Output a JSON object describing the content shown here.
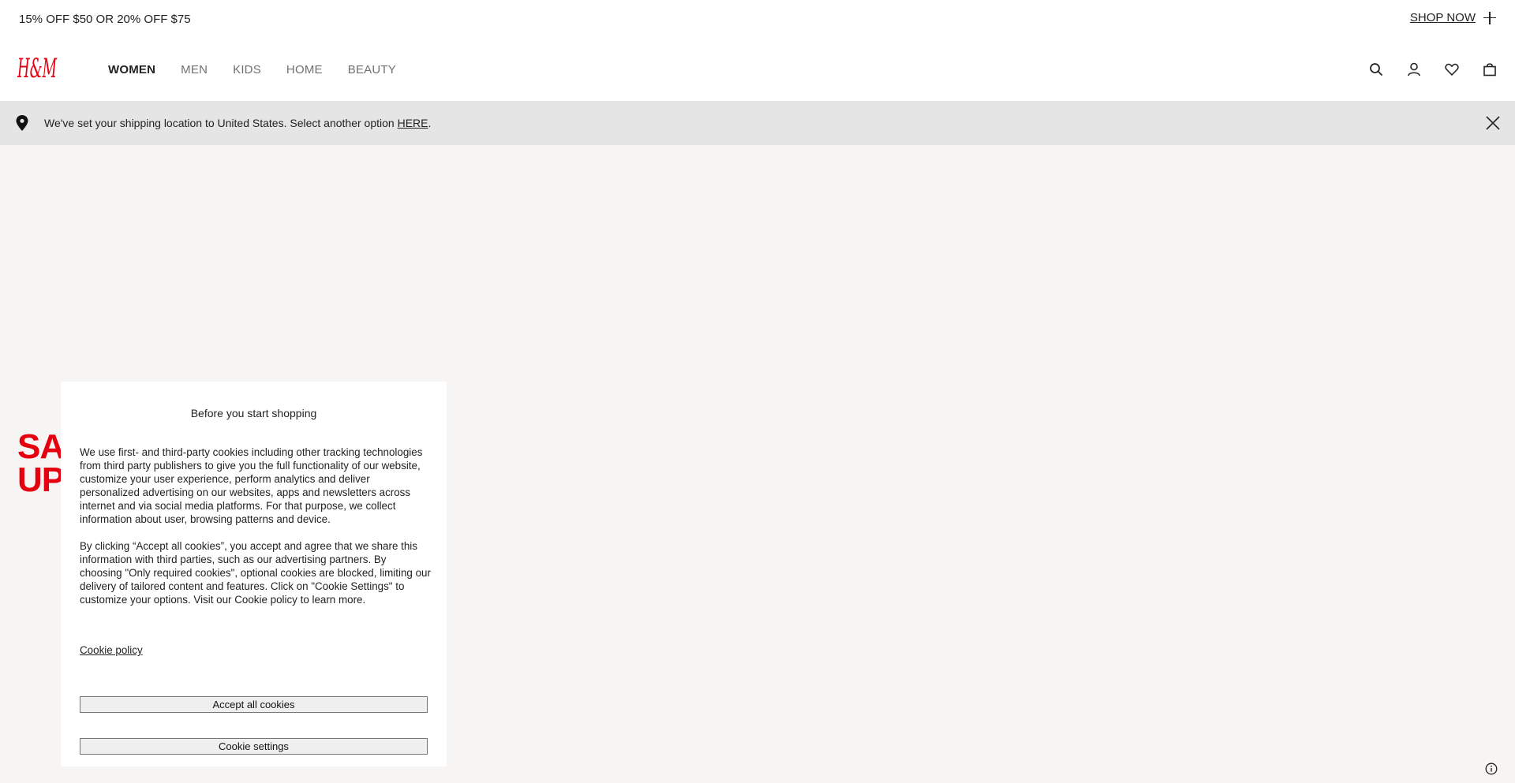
{
  "promo": {
    "text": "15% OFF $50 OR 20% OFF $75",
    "cta_label": "SHOP NOW"
  },
  "header": {
    "logo_text": "H&M",
    "nav": [
      {
        "label": "WOMEN",
        "active": true
      },
      {
        "label": "MEN",
        "active": false
      },
      {
        "label": "KIDS",
        "active": false
      },
      {
        "label": "HOME",
        "active": false
      },
      {
        "label": "BEAUTY",
        "active": false
      }
    ],
    "icons": [
      "search-icon",
      "account-icon",
      "favorites-icon",
      "shopping-bag-icon"
    ]
  },
  "shipping": {
    "text": "We've set your shipping location to United States. Select another option ",
    "link": "HERE",
    "suffix": "."
  },
  "hero": {
    "line1": "SA",
    "line2": "UP"
  },
  "cookie": {
    "title": "Before you start shopping",
    "paragraph1": "We use first- and third-party cookies including other tracking technologies from third party publishers to give you the full functionality of our website, customize your user experience, perform analytics and deliver personalized advertising on our websites, apps and newsletters across internet and via social media platforms. For that purpose, we collect information about user, browsing patterns and device.",
    "paragraph2": "By clicking “Accept all cookies”, you accept and agree that we share this information with third parties, such as our advertising partners. By choosing \"Only required cookies\", optional cookies are blocked, limiting our delivery of tailored content and features. Click on \"Cookie Settings\" to customize your options. Visit our Cookie policy to learn more.",
    "policy_link": "Cookie policy",
    "accept_label": "Accept all cookies",
    "settings_label": "Cookie settings"
  },
  "colors": {
    "brand_red": "#e50010",
    "shipping_bg": "#e5e5e5",
    "page_bg": "#f6f5f3"
  }
}
